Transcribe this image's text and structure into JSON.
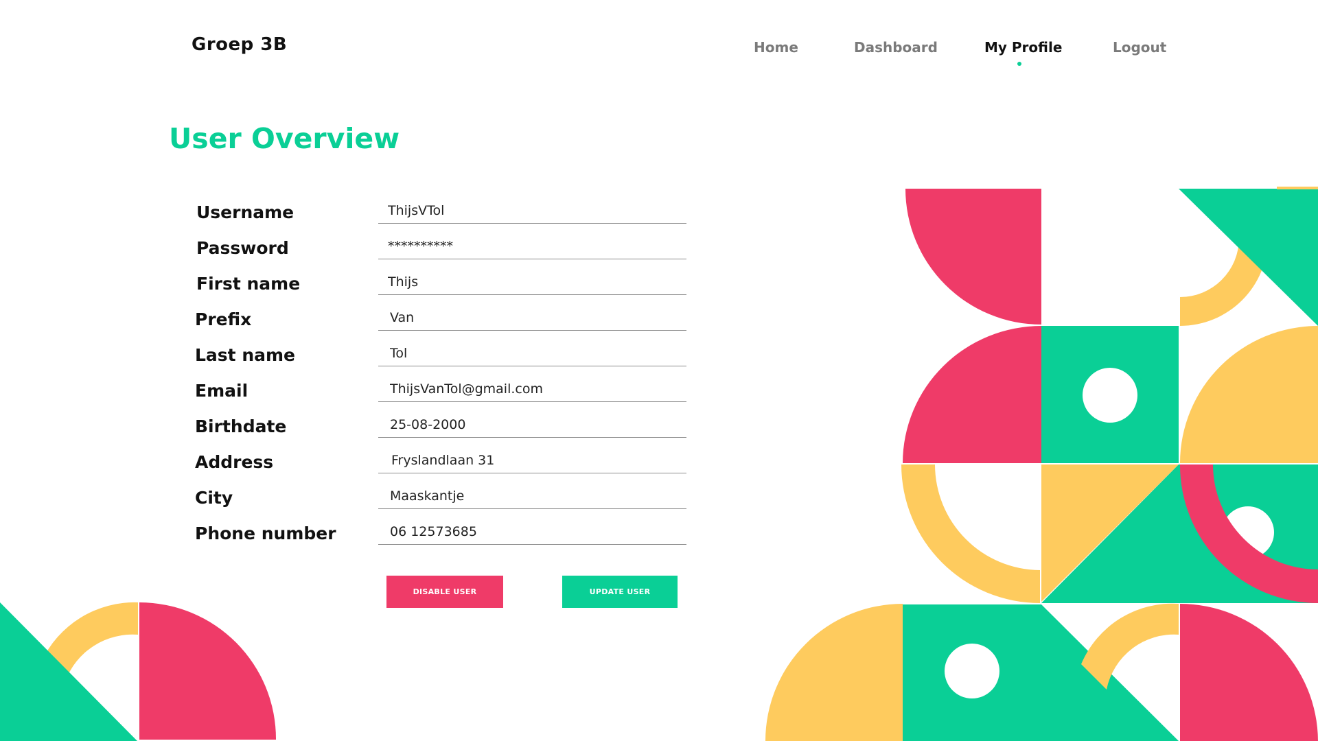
{
  "header": {
    "brand": "Groep 3B",
    "nav": {
      "home": "Home",
      "dashboard": "Dashboard",
      "my_profile": "My Profile",
      "logout": "Logout",
      "active": "my_profile"
    }
  },
  "main": {
    "title": "User Overview",
    "fields": {
      "username": {
        "label": "Username",
        "value": "ThijsVTol"
      },
      "password": {
        "label": "Password",
        "value": "**********"
      },
      "first_name": {
        "label": "First name",
        "value": "Thijs"
      },
      "prefix": {
        "label": "Prefix",
        "value": "Van"
      },
      "last_name": {
        "label": "Last name",
        "value": "Tol"
      },
      "email": {
        "label": "Email",
        "value": "ThijsVanTol@gmail.com"
      },
      "birthdate": {
        "label": "Birthdate",
        "value": "25-08-2000"
      },
      "address": {
        "label": "Address",
        "value": "Fryslandlaan 31"
      },
      "city": {
        "label": "City",
        "value": "Maaskantje"
      },
      "phone": {
        "label": "Phone number",
        "value": "06 12573685"
      }
    },
    "buttons": {
      "disable": "DISABLE USER",
      "update": "UPDATE USER"
    }
  },
  "colors": {
    "green": "#0acf96",
    "pink": "#ef3b68",
    "yellow": "#fecb5e",
    "text": "#111111",
    "nav_inactive": "#7a7a7a"
  }
}
